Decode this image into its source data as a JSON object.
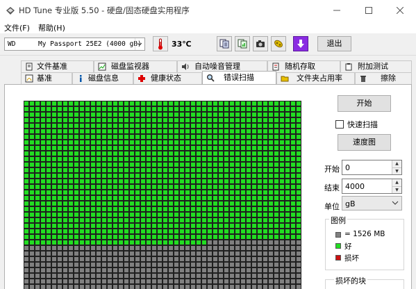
{
  "window": {
    "title": "HD Tune 专业版 5.50 - 硬盘/固态硬盘实用程序"
  },
  "menu": {
    "file": "文件(F)",
    "help": "帮助(H)"
  },
  "toolbar": {
    "drive_vendor": "WD",
    "drive_name": "My Passport 25E2 (4000 gB)",
    "temperature": "33℃",
    "exit_label": "退出"
  },
  "tabs": {
    "row1": [
      "文件基准",
      "磁盘监视器",
      "自动噪音管理",
      "随机存取",
      "附加测试"
    ],
    "row2": [
      "基准",
      "磁盘信息",
      "健康状态",
      "错误扫描",
      "文件夹占用率",
      "擦除"
    ]
  },
  "controls": {
    "start_label": "开始",
    "quick_scan_label": "快速扫描",
    "quick_scan_checked": false,
    "speed_map_label": "速度图",
    "start_field_label": "开始",
    "start_value": "0",
    "end_field_label": "结束",
    "end_value": "4000",
    "unit_label": "单位",
    "unit_value": "gB"
  },
  "legend": {
    "title": "图例",
    "block_size": "= 1526 MB",
    "ok": "好",
    "bad": "损坏",
    "colors": {
      "untested": "#808080",
      "ok": "#22dd22",
      "bad": "#cc1111"
    }
  },
  "bad_blocks": {
    "title": "损坏的块"
  },
  "scan_grid": {
    "columns": 50,
    "full_green_rows": 25,
    "partial_row_green_cells": 33
  }
}
